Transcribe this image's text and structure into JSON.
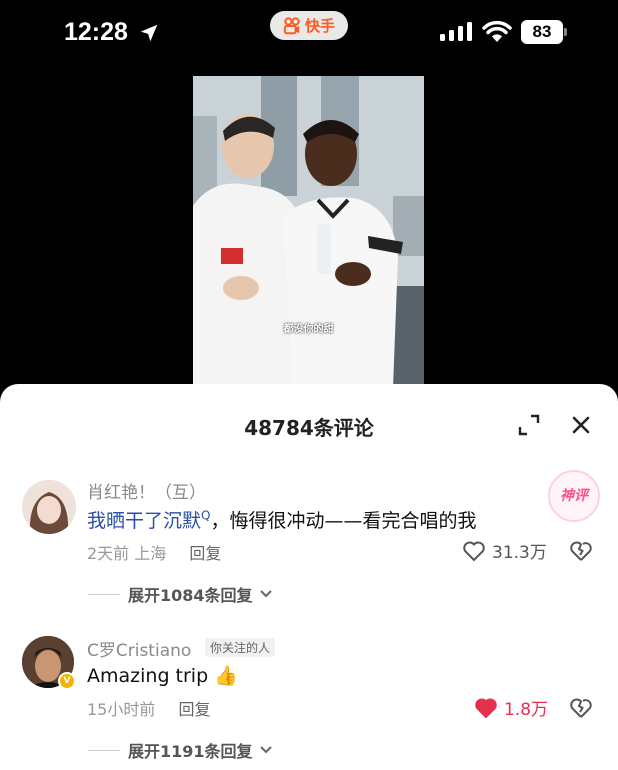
{
  "status_bar": {
    "time": "12:28",
    "app_name": "快手",
    "battery": "83"
  },
  "video": {
    "subtitle": "都没你的甜"
  },
  "comments_panel": {
    "title": "48784条评论",
    "comments": [
      {
        "username": "肖红艳！（互）",
        "text_link": "我晒干了沉默",
        "text_rest": "，悔得很冲动——看完合唱的我",
        "time": "2天前",
        "location": "上海",
        "reply_label": "回复",
        "likes": "31.3万",
        "badge": "神评",
        "expand_label": "展开1084条回复"
      },
      {
        "username": "C罗Cristiano",
        "follow_tag": "你关注的人",
        "text": "Amazing trip",
        "emoji": "👍",
        "time": "15小时前",
        "reply_label": "回复",
        "likes": "1.8万",
        "expand_label": "展开1191条回复"
      }
    ]
  },
  "colors": {
    "accent_like": "#e5304d",
    "link_blue": "#2a4fa8",
    "app_orange": "#ff5a1f"
  }
}
